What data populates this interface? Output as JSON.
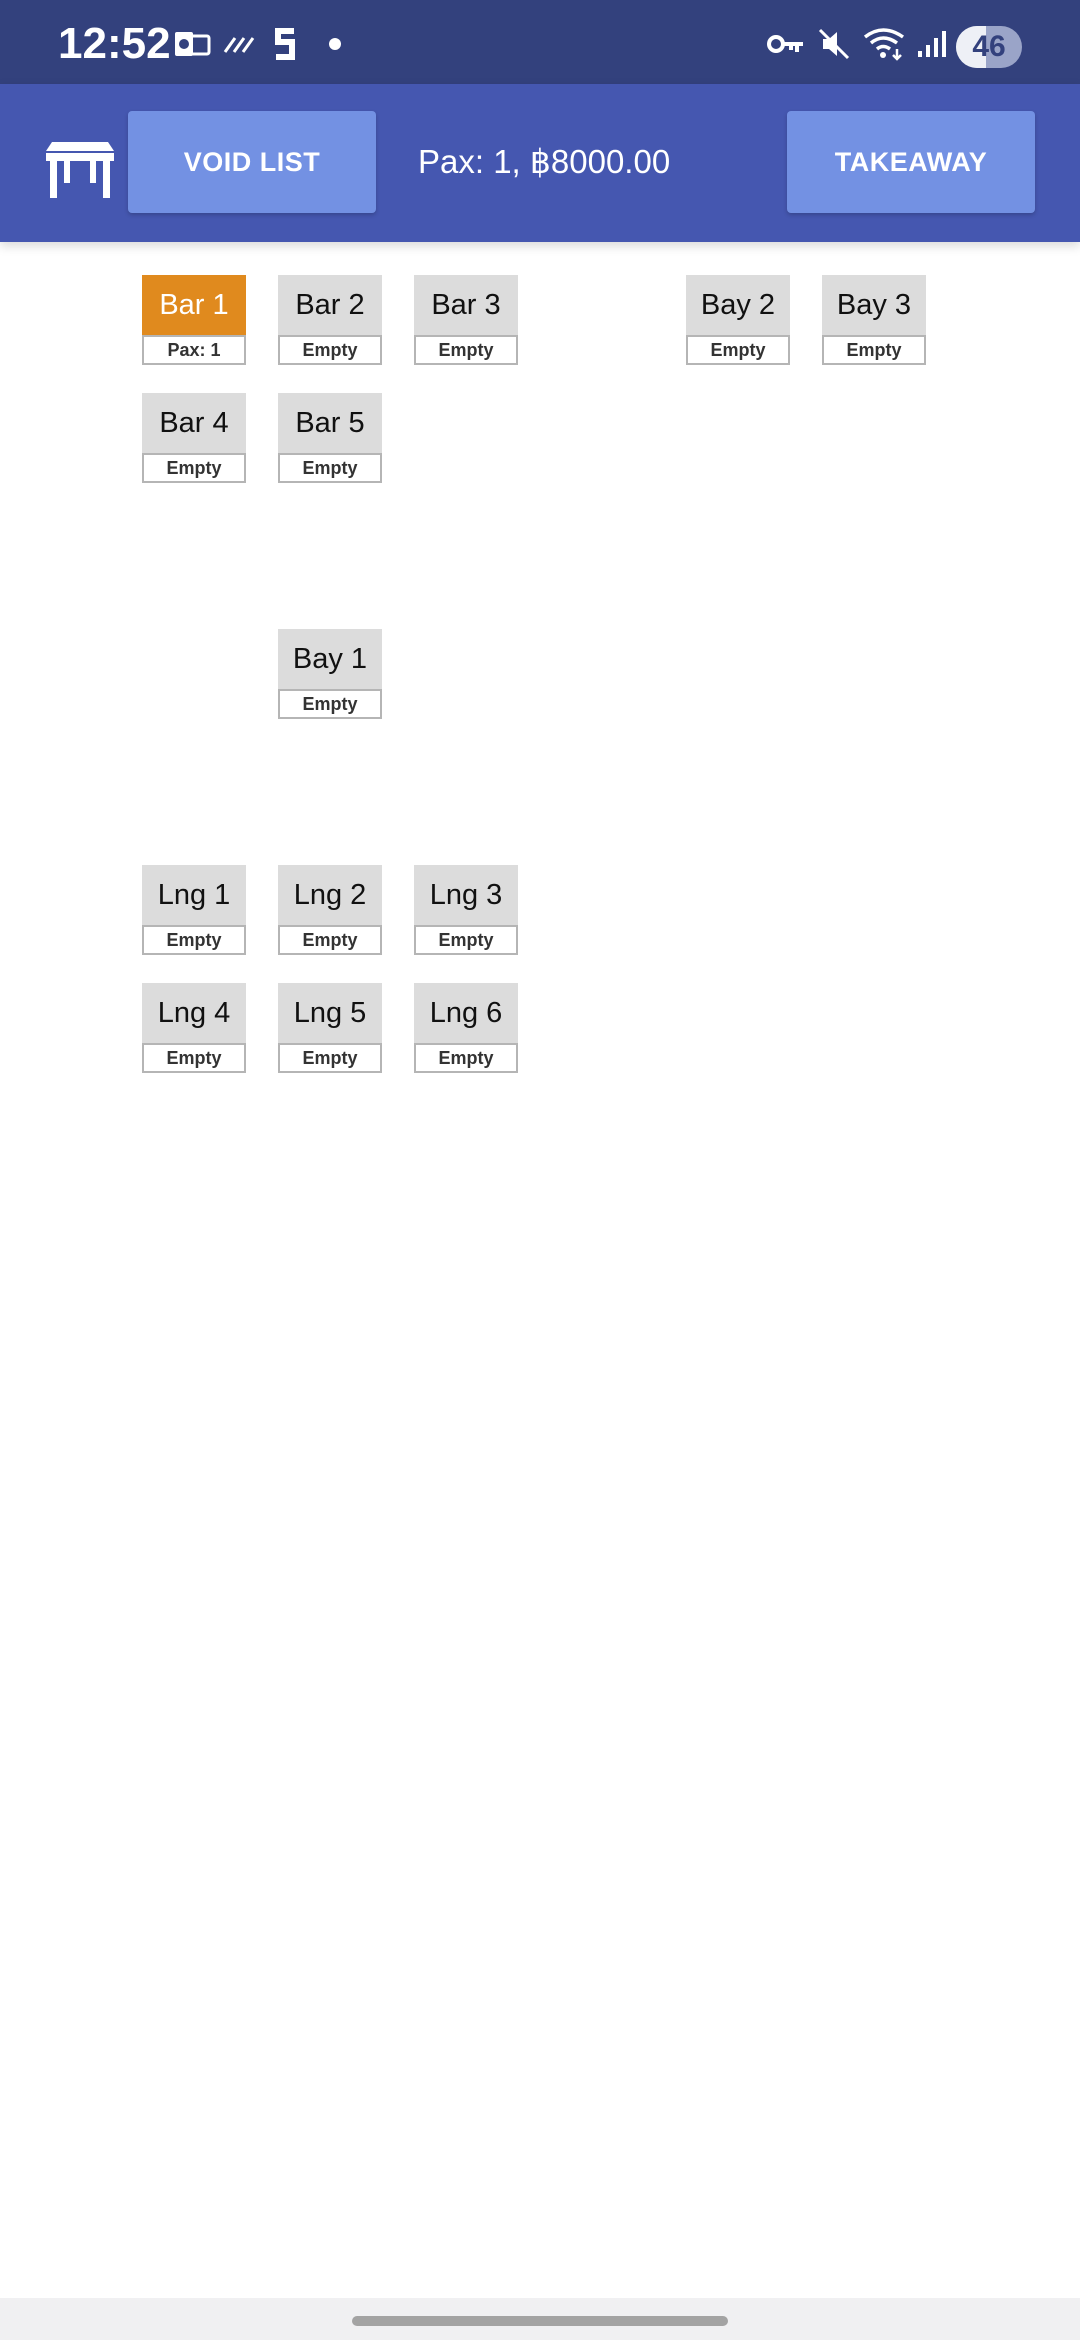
{
  "status_bar": {
    "time": "12:52",
    "battery": "46",
    "battery_level_percent": 46,
    "left_icons": [
      "outlook-icon",
      "stripes-icon",
      "s-app-icon",
      "dot-icon"
    ],
    "right_icons": [
      "vpn-key-icon",
      "mute-icon",
      "wifi-icon",
      "signal-icon"
    ]
  },
  "app_bar": {
    "void_list_label": "VOID LIST",
    "pax_summary": "Pax: 1, ฿8000.00",
    "takeaway_label": "TAKEAWAY",
    "background": "#4557b0",
    "button_color": "#7391e3"
  },
  "tables": [
    {
      "name": "Bar 1",
      "status": "Pax: 1",
      "active": true
    },
    {
      "name": "Bar 2",
      "status": "Empty",
      "active": false
    },
    {
      "name": "Bar 3",
      "status": "Empty",
      "active": false
    },
    {
      "name": "Bay 2",
      "status": "Empty",
      "active": false
    },
    {
      "name": "Bay 3",
      "status": "Empty",
      "active": false
    },
    {
      "name": "Bar 4",
      "status": "Empty",
      "active": false
    },
    {
      "name": "Bar 5",
      "status": "Empty",
      "active": false
    },
    {
      "name": "Bay 1",
      "status": "Empty",
      "active": false
    },
    {
      "name": "Lng 1",
      "status": "Empty",
      "active": false
    },
    {
      "name": "Lng 2",
      "status": "Empty",
      "active": false
    },
    {
      "name": "Lng 3",
      "status": "Empty",
      "active": false
    },
    {
      "name": "Lng 4",
      "status": "Empty",
      "active": false
    },
    {
      "name": "Lng 5",
      "status": "Empty",
      "active": false
    },
    {
      "name": "Lng 6",
      "status": "Empty",
      "active": false
    }
  ],
  "colors": {
    "occupied_table": "#e08a1e",
    "empty_table": "#dcdcdc",
    "status_bar": "#33417d"
  }
}
